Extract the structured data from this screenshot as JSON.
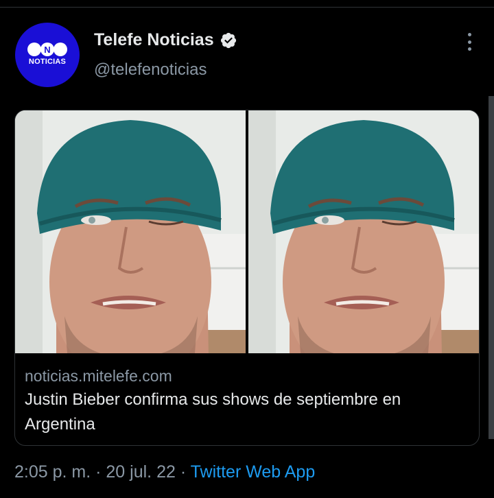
{
  "tweet": {
    "avatar_lines": [
      "N",
      "NOTICIAS"
    ],
    "display_name": "Telefe Noticias",
    "handle": "@telefenoticias",
    "verified": true,
    "more_icon": "more-vertical-icon",
    "card": {
      "image_count": 2,
      "domain": "noticias.mitelefe.com",
      "title": "Justin Bieber confirma sus shows de septiembre en Argentina"
    },
    "time": "2:05 p. m.",
    "date": "20 jul. 22",
    "separator": "·",
    "source_app": "Twitter Web App"
  },
  "colors": {
    "background": "#000000",
    "avatar_blue": "#1a0fd6",
    "link_blue": "#1d9bf0",
    "muted_text": "#8b98a5",
    "beanie_teal": "#1f6f73"
  }
}
